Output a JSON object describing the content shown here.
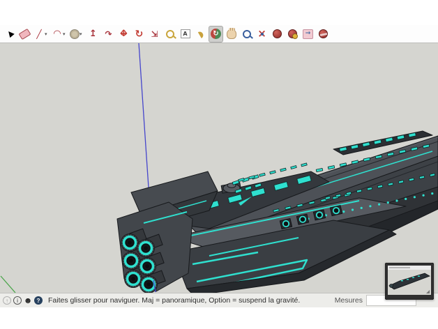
{
  "theme": {
    "accent": "#2fe0cf",
    "viewport_bg": "#d5d5d0",
    "axis_blue": "#4545cc",
    "axis_green": "#4aa54a"
  },
  "toolbar": {
    "tools": [
      {
        "name": "select",
        "glyph": "▶",
        "dropdown": false,
        "selected": false
      },
      {
        "name": "eraser",
        "glyph": "",
        "dropdown": false,
        "selected": false
      },
      {
        "name": "line",
        "glyph": "╱",
        "dropdown": true,
        "selected": false
      },
      {
        "name": "arc",
        "glyph": "◠",
        "dropdown": true,
        "selected": false
      },
      {
        "name": "shapes",
        "glyph": "",
        "dropdown": true,
        "selected": false
      },
      {
        "name": "push-pull",
        "glyph": "↥",
        "dropdown": false,
        "selected": false
      },
      {
        "name": "follow-me",
        "glyph": "↷",
        "dropdown": false,
        "selected": false
      },
      {
        "name": "move",
        "glyph": "",
        "dropdown": false,
        "selected": false
      },
      {
        "name": "rotate",
        "glyph": "↻",
        "dropdown": false,
        "selected": false
      },
      {
        "name": "scale",
        "glyph": "⇲",
        "dropdown": false,
        "selected": false
      },
      {
        "name": "tape-measure",
        "glyph": "",
        "dropdown": false,
        "selected": false
      },
      {
        "name": "text",
        "glyph": "A",
        "dropdown": false,
        "selected": false
      },
      {
        "name": "paint-bucket",
        "glyph": "◗",
        "dropdown": false,
        "selected": false
      },
      {
        "name": "orbit",
        "glyph": "↻",
        "dropdown": false,
        "selected": true
      },
      {
        "name": "pan",
        "glyph": "",
        "dropdown": false,
        "selected": false
      },
      {
        "name": "zoom",
        "glyph": "",
        "dropdown": false,
        "selected": false
      },
      {
        "name": "zoom-extents",
        "glyph": "×",
        "dropdown": false,
        "selected": false
      },
      {
        "name": "3d-warehouse",
        "glyph": "",
        "dropdown": false,
        "selected": false
      },
      {
        "name": "get-models",
        "glyph": "",
        "dropdown": false,
        "selected": false
      },
      {
        "name": "share-model",
        "glyph": "→",
        "dropdown": false,
        "selected": false
      },
      {
        "name": "extension-warehouse",
        "glyph": "",
        "dropdown": false,
        "selected": false
      }
    ]
  },
  "status_bar": {
    "icons": [
      {
        "name": "status-nav-icon",
        "glyph": "↑",
        "variant": "ring-dim"
      },
      {
        "name": "status-info-icon",
        "glyph": "i",
        "variant": "ring"
      },
      {
        "name": "status-user-icon",
        "glyph": "☻",
        "variant": "plain"
      },
      {
        "name": "status-help-icon",
        "glyph": "?",
        "variant": "solid"
      }
    ],
    "message": "Faites glisser pour naviguer. Maj = panoramique, Option = suspend la gravité.",
    "measure_label": "Mesures",
    "measure_value": ""
  }
}
